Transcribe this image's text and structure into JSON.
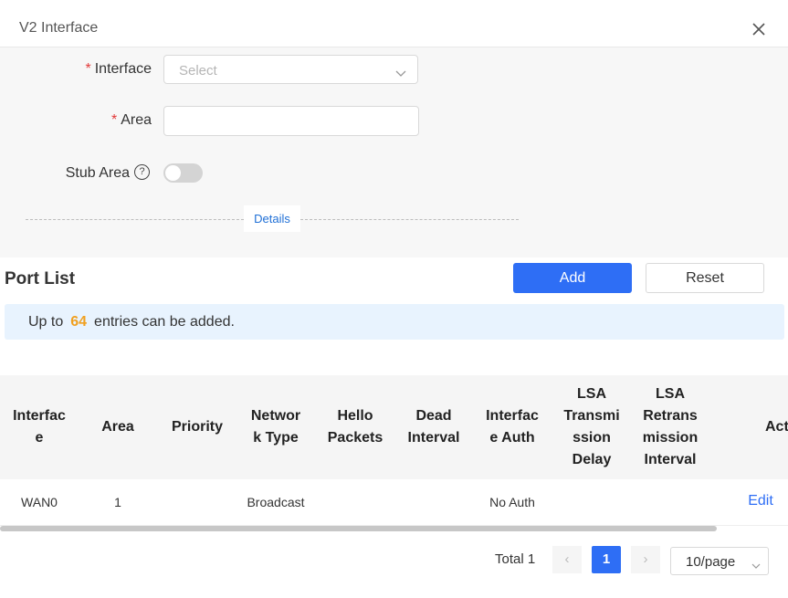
{
  "dialog": {
    "title": "V2 Interface"
  },
  "form": {
    "interface_label": "Interface",
    "interface_placeholder": "Select",
    "area_label": "Area",
    "area_value": "",
    "stub_area_label": "Stub Area",
    "stub_area_enabled": false,
    "help_glyph": "?",
    "details_label": "Details",
    "required_mark": "*"
  },
  "port_list": {
    "title": "Port List",
    "add_label": "Add",
    "reset_label": "Reset",
    "notice_prefix": "Up to",
    "notice_count": "64",
    "notice_suffix": "entries can be added."
  },
  "table": {
    "columns": [
      "Interfac e",
      "Area",
      "Priority",
      "Networ k Type",
      "Hello Packets",
      "Dead Interval",
      "Interfac e Auth",
      "LSA Transmi ssion Delay",
      "LSA Retrans mission Interval",
      "Act"
    ],
    "rows": [
      {
        "interface": "WAN0",
        "area": "1",
        "priority": "",
        "network_type": "Broadcast",
        "hello": "",
        "dead": "",
        "auth": "No Auth",
        "lsa_delay": "",
        "lsa_retrans": "",
        "action": "Edit"
      }
    ]
  },
  "pagination": {
    "total_label": "Total 1",
    "current_page": "1",
    "prev_glyph": "‹",
    "next_glyph": "›",
    "page_size": "10/page"
  },
  "colors": {
    "primary": "#2e6ef5",
    "required": "#e23b3b",
    "count": "#f0a020"
  }
}
